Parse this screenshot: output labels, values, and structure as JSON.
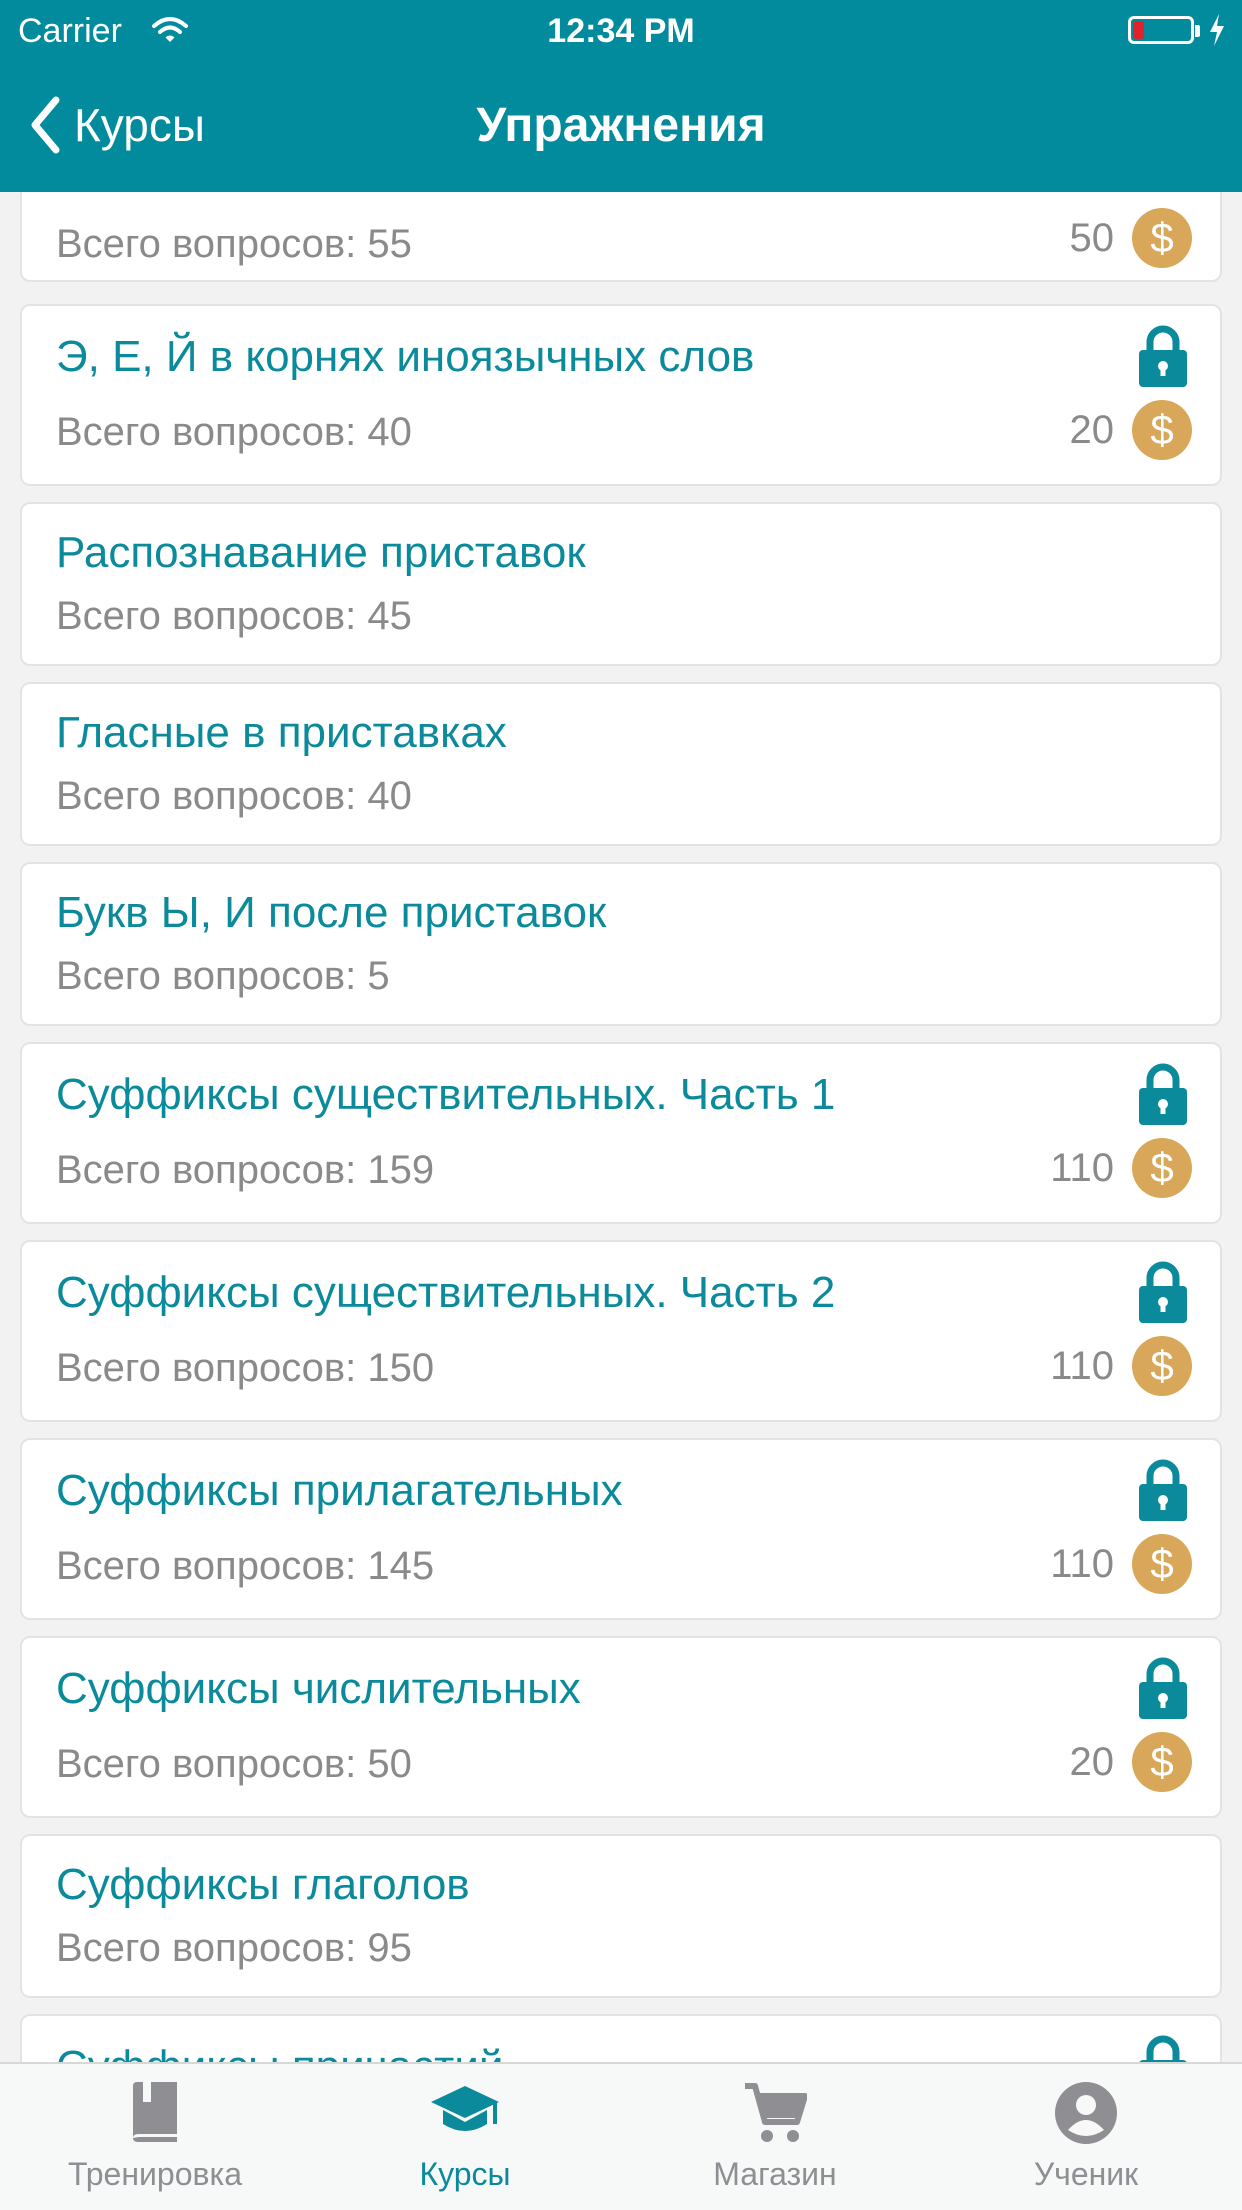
{
  "status_bar": {
    "carrier": "Carrier",
    "time": "12:34 PM",
    "battery_level": 0.2
  },
  "nav": {
    "back_label": "Курсы",
    "title": "Упражнения"
  },
  "colors": {
    "primary": "#018b9d",
    "title_text": "#0a8a9a",
    "coin": "#d9a75a",
    "muted": "#8a8a8a"
  },
  "exercises": [
    {
      "title": "",
      "subtitle": "Всего вопросов: 55",
      "locked": false,
      "price": "50"
    },
    {
      "title": "Э, Е, Й в корнях иноязычных слов",
      "subtitle": "Всего вопросов: 40",
      "locked": true,
      "price": "20"
    },
    {
      "title": "Распознавание приставок",
      "subtitle": "Всего вопросов: 45",
      "locked": false,
      "price": ""
    },
    {
      "title": "Гласные в приставках",
      "subtitle": "Всего вопросов: 40",
      "locked": false,
      "price": ""
    },
    {
      "title": "Букв Ы, И после приставок",
      "subtitle": "Всего вопросов: 5",
      "locked": false,
      "price": ""
    },
    {
      "title": "Суффиксы существительных. Часть 1",
      "subtitle": "Всего вопросов: 159",
      "locked": true,
      "price": "110"
    },
    {
      "title": "Суффиксы существительных. Часть 2",
      "subtitle": "Всего вопросов: 150",
      "locked": true,
      "price": "110"
    },
    {
      "title": "Суффиксы прилагательных",
      "subtitle": "Всего вопросов: 145",
      "locked": true,
      "price": "110"
    },
    {
      "title": "Суффиксы числительных",
      "subtitle": "Всего вопросов: 50",
      "locked": true,
      "price": "20"
    },
    {
      "title": "Суффиксы глаголов",
      "subtitle": "Всего вопросов: 95",
      "locked": false,
      "price": ""
    },
    {
      "title": "Суффиксы причастий",
      "subtitle": "",
      "locked": true,
      "price": ""
    }
  ],
  "tabs": [
    {
      "label": "Тренировка",
      "icon": "book-icon",
      "active": false
    },
    {
      "label": "Курсы",
      "icon": "graduation-cap-icon",
      "active": true
    },
    {
      "label": "Магазин",
      "icon": "cart-icon",
      "active": false
    },
    {
      "label": "Ученик",
      "icon": "user-icon",
      "active": false
    }
  ]
}
